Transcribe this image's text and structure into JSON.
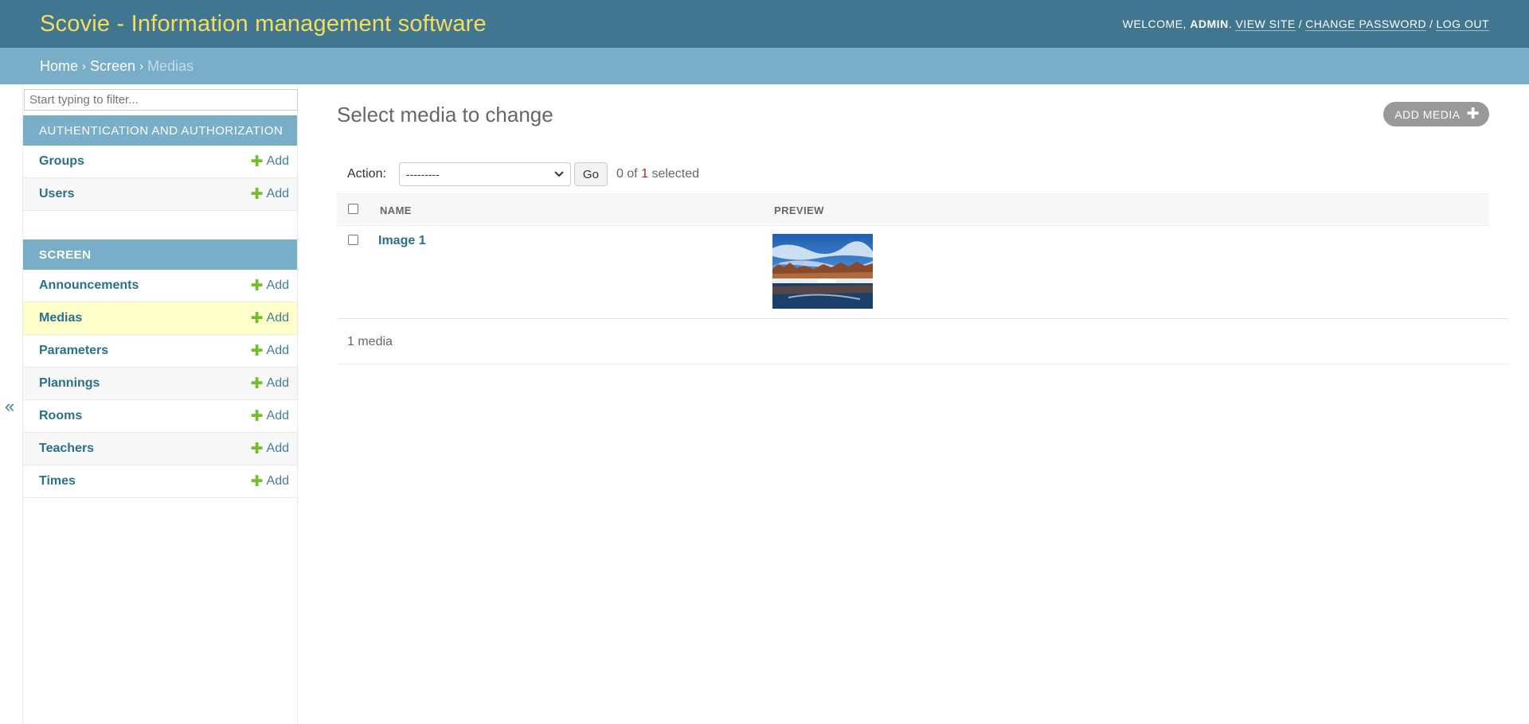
{
  "header": {
    "site_title": "Scovie - Information management software",
    "welcome": "Welcome,",
    "user": "admin",
    "view_site": "View site",
    "change_password": "Change password",
    "log_out": "Log out"
  },
  "breadcrumbs": {
    "home": "Home",
    "app": "Screen",
    "current": "Medias",
    "separator": "›"
  },
  "sidebar": {
    "toggle": "«",
    "filter_placeholder": "Start typing to filter...",
    "modules": [
      {
        "caption": "Authentication and Authorization",
        "models": [
          {
            "name": "Groups",
            "add": "Add"
          },
          {
            "name": "Users",
            "add": "Add"
          }
        ]
      },
      {
        "caption": "Screen",
        "models": [
          {
            "name": "Announcements",
            "add": "Add"
          },
          {
            "name": "Medias",
            "add": "Add"
          },
          {
            "name": "Parameters",
            "add": "Add"
          },
          {
            "name": "Plannings",
            "add": "Add"
          },
          {
            "name": "Rooms",
            "add": "Add"
          },
          {
            "name": "Teachers",
            "add": "Add"
          },
          {
            "name": "Times",
            "add": "Add"
          }
        ]
      }
    ]
  },
  "content": {
    "title": "Select media to change",
    "add_button": "Add media",
    "actions": {
      "label": "Action:",
      "select_value": "---------",
      "go": "Go",
      "selected_prefix": "0 of",
      "selected_total": "1",
      "selected_suffix": "selected"
    },
    "table": {
      "headers": [
        "Name",
        "Preview"
      ],
      "rows": [
        {
          "name": "Image 1"
        }
      ]
    },
    "paginator": "1 media"
  },
  "colors": {
    "header_bg": "#417690",
    "branding": "#f5dd5d",
    "breadcrumb_bg": "#79aec8",
    "module_caption_bg": "#79aec8",
    "link": "#29708c",
    "add_plus": "#70bf2b",
    "current_row": "#ffffcc"
  }
}
